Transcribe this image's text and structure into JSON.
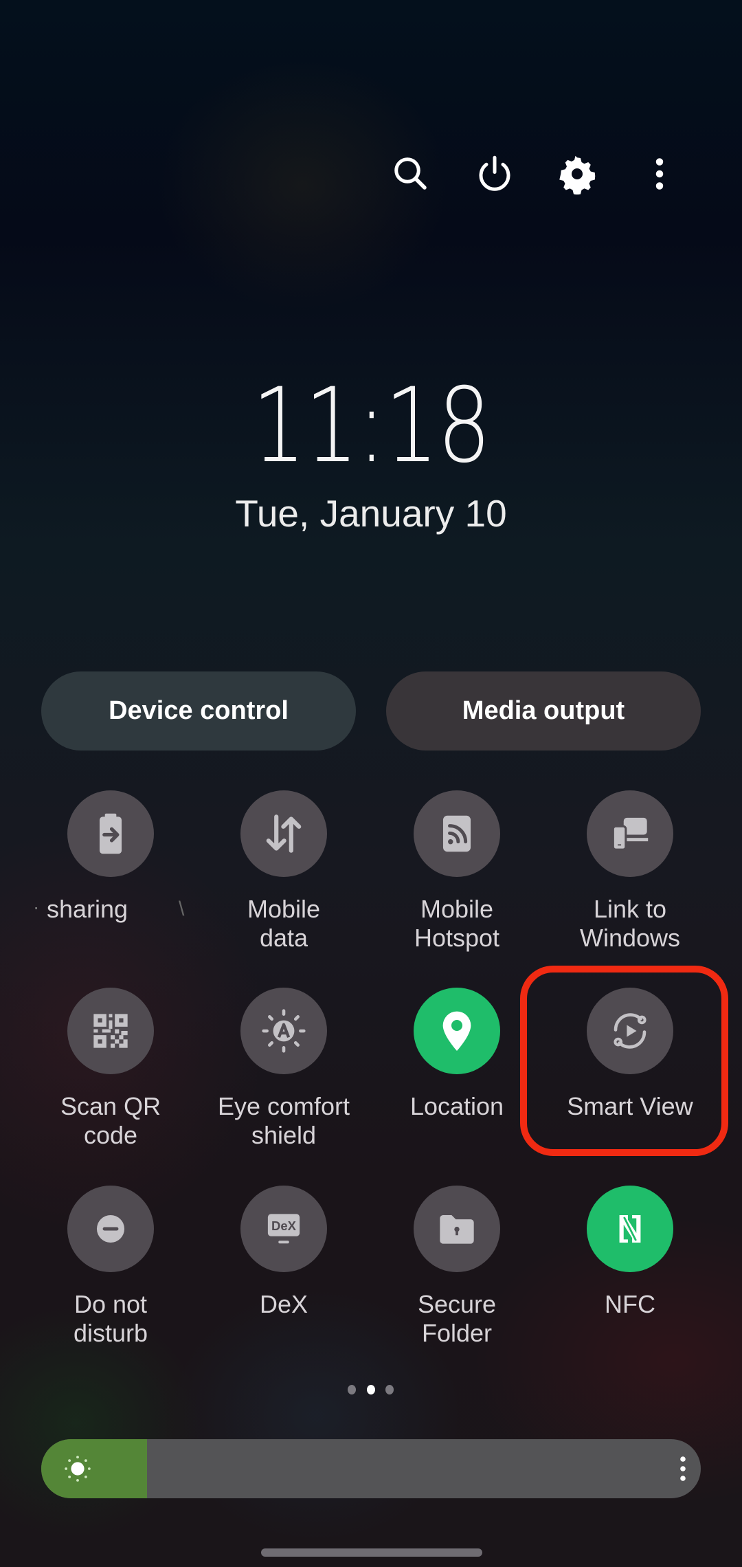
{
  "header": {
    "icons": [
      {
        "name": "search-icon",
        "label": "Search"
      },
      {
        "name": "power-icon",
        "label": "Power"
      },
      {
        "name": "settings-gear-icon",
        "label": "Settings"
      },
      {
        "name": "more-options-icon",
        "label": "More options"
      }
    ]
  },
  "clock": {
    "time": "11:18",
    "date": "Tue, January 10"
  },
  "quick_buttons": {
    "device_control": "Device control",
    "media_output": "Media output"
  },
  "tiles": [
    {
      "label": "sharing",
      "icon": "battery-share-icon",
      "active": false
    },
    {
      "label": "Mobile\ndata",
      "icon": "mobile-data-icon",
      "active": false
    },
    {
      "label": "Mobile\nHotspot",
      "icon": "hotspot-icon",
      "active": false
    },
    {
      "label": "Link to\nWindows",
      "icon": "link-to-windows-icon",
      "active": false
    },
    {
      "label": "Scan QR\ncode",
      "icon": "qr-code-icon",
      "active": false
    },
    {
      "label": "Eye comfort\nshield",
      "icon": "eye-comfort-icon",
      "active": false
    },
    {
      "label": "Location",
      "icon": "location-pin-icon",
      "active": true
    },
    {
      "label": "Smart View",
      "icon": "smart-view-icon",
      "active": false
    },
    {
      "label": "Do not\ndisturb",
      "icon": "do-not-disturb-icon",
      "active": false
    },
    {
      "label": "DeX",
      "icon": "dex-icon",
      "active": false
    },
    {
      "label": "Secure\nFolder",
      "icon": "secure-folder-icon",
      "active": false
    },
    {
      "label": "NFC",
      "icon": "nfc-icon",
      "active": true
    }
  ],
  "highlighted_tile": "Smart View",
  "pagination": {
    "total": 3,
    "current": 2
  },
  "brightness": {
    "level_percent": 16
  },
  "colors": {
    "tile_on": "#1fbd6a",
    "tile_off": "#504b51",
    "brightness_fill": "#548637",
    "highlight": "#f02a12"
  }
}
